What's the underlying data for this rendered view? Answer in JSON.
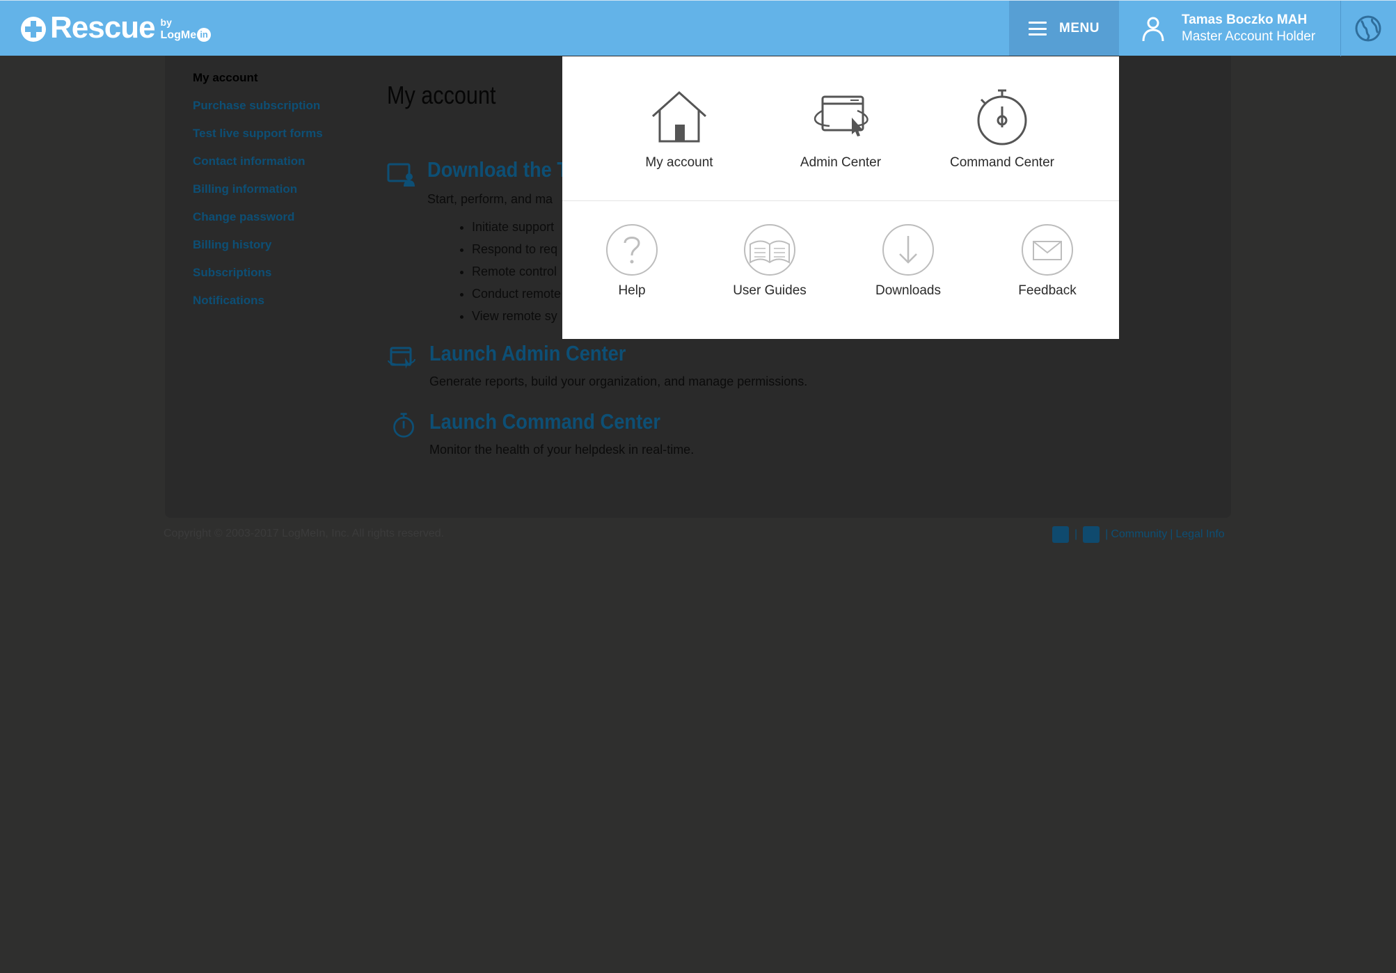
{
  "header": {
    "logo_word": "Rescue",
    "logo_by": "by",
    "logo_brand": "LogMe",
    "logo_in": "in",
    "menu_label": "MENU",
    "user_name": "Tamas Boczko MAH",
    "user_role": "Master Account Holder"
  },
  "sidebar": {
    "items": [
      {
        "label": "My account",
        "active": true
      },
      {
        "label": "Purchase subscription"
      },
      {
        "label": "Test live support forms"
      },
      {
        "label": "Contact information"
      },
      {
        "label": "Billing information"
      },
      {
        "label": "Change password"
      },
      {
        "label": "Billing history"
      },
      {
        "label": "Subscriptions"
      },
      {
        "label": "Notifications"
      }
    ]
  },
  "main": {
    "title": "My account",
    "download": {
      "title": "Download the T",
      "desc": "Start, perform, and ma",
      "bullets": [
        "Initiate support",
        "Respond to req",
        "Remote control",
        "Conduct remote",
        "View remote sy"
      ]
    },
    "admin": {
      "title": "Launch Admin Center",
      "desc": "Generate reports, build your organization, and manage permissions."
    },
    "command": {
      "title": "Launch Command Center",
      "desc": "Monitor the health of your helpdesk in real-time."
    }
  },
  "footer": {
    "copyright": "Copyright © 2003-2017 LogMeIn, Inc. All rights reserved.",
    "sep": "|",
    "community": "Community",
    "legal": "Legal Info"
  },
  "menu": {
    "row1": [
      {
        "label": "My account",
        "icon": "home-icon"
      },
      {
        "label": "Admin Center",
        "icon": "admin-window-icon"
      },
      {
        "label": "Command Center",
        "icon": "stopwatch-icon"
      }
    ],
    "row2": [
      {
        "label": "Help",
        "icon": "question-icon"
      },
      {
        "label": "User Guides",
        "icon": "book-icon"
      },
      {
        "label": "Downloads",
        "icon": "download-icon"
      },
      {
        "label": "Feedback",
        "icon": "envelope-icon"
      }
    ]
  },
  "colors": {
    "header": "#63b3e8",
    "menu_button": "#579fd4",
    "link": "#0d4f75",
    "overlay_bg": "#2f2f2e"
  }
}
